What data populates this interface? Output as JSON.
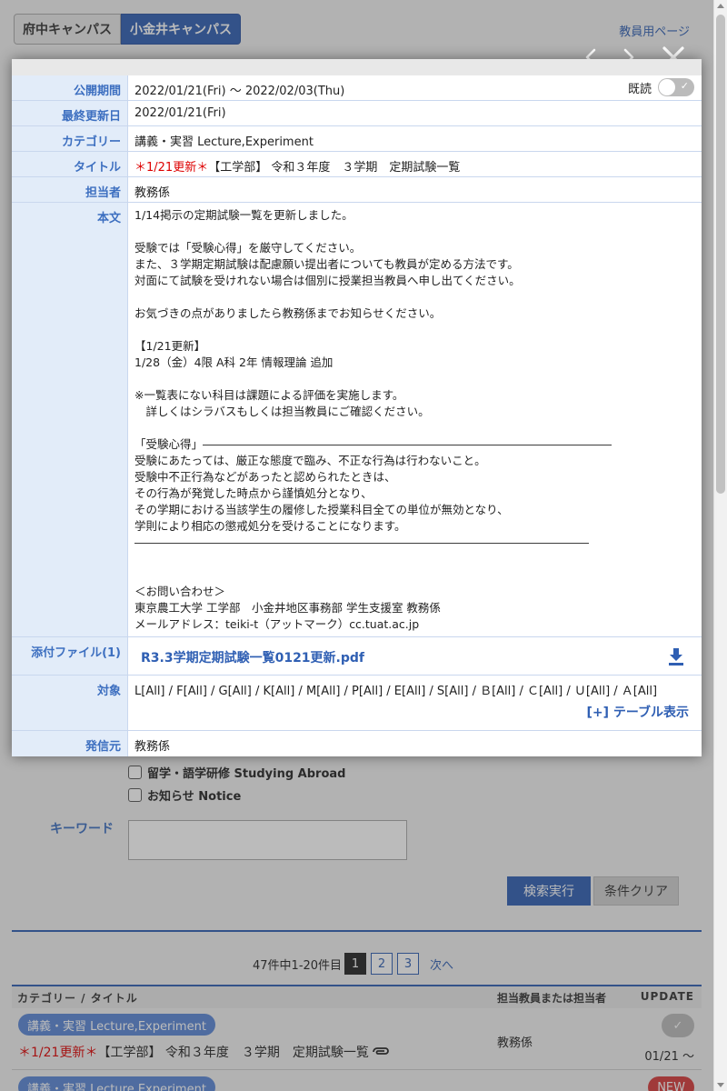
{
  "header": {
    "campus_tabs": [
      {
        "label": "府中キャンパス",
        "active": false
      },
      {
        "label": "小金井キャンパス",
        "active": true
      }
    ],
    "faculty_link": "教員用ページ"
  },
  "detail": {
    "rows": {
      "period": {
        "label": "公開期間",
        "value": "2022/01/21(Fri) 〜 2022/02/03(Thu)"
      },
      "updated": {
        "label": "最終更新日",
        "value": "2022/01/21(Fri)"
      },
      "category": {
        "label": "カテゴリー",
        "value": "講義・実習 Lecture,Experiment"
      },
      "title": {
        "label": "タイトル",
        "prefix": "＊1/21更新＊",
        "value": "【工学部】 令和３年度　３学期　定期試験一覧"
      },
      "person": {
        "label": "担当者",
        "value": "教務係"
      },
      "body": {
        "label": "本文",
        "value": "1/14掲示の定期試験一覧を更新しました。\n\n受験では「受験心得」を厳守してください。\nまた、３学期定期試験は配慮願い提出者についても教員が定める方法です。\n対面にて試験を受けれない場合は個別に授業担当教員へ申し出てください。\n\nお気づきの点がありましたら教務係までお知らせください。\n\n【1/21更新】\n1/28（金）4限 A科 2年 情報理論 追加\n\n※一覧表にない科目は課題による評価を実施します。\n　詳しくはシラバスもしくは担当教員にご確認ください。\n\n「受験心得」――――――――――――――――――――――――――――――――――――\n受験にあたっては、厳正な態度で臨み、不正な行為は行わないこと。\n受験中不正行為などがあったと認められたときは、\nその行為が発覚した時点から謹慎処分となり、\nその学期における当該学生の履修した授業科目全ての単位が無効となり、\n学則により相応の懲戒処分を受けることになります。\n――――――――――――――――――――――――――――――――――――――――\n\n\n＜お問い合わせ＞\n東京農工大学 工学部　小金井地区事務部 学生支援室 教務係\nメールアドレス：teiki-t（アットマーク）cc.tuat.ac.jp"
      },
      "attachment": {
        "label": "添付ファイル(1)",
        "file": "R3.3学期定期試験一覧0121更新.pdf"
      },
      "target": {
        "label": "対象",
        "value": "L[All] / F[All] / G[All] / K[All] / M[All] / P[All] / E[All] / S[All] / Ｂ[All] / Ｃ[All] / Ｕ[All] / Ａ[All]",
        "table_toggle": "[+] テーブル表示"
      },
      "sender": {
        "label": "発信元",
        "value": "教務係"
      }
    },
    "read_label": "既読",
    "read_checked": false
  },
  "search": {
    "checkboxes": [
      "留学・語学研修 Studying Abroad",
      "お知らせ Notice"
    ],
    "keyword_label": "キーワード",
    "search_button": "検索実行",
    "clear_button": "条件クリア"
  },
  "pager": {
    "count_text": "47件中1-20件目",
    "pages": [
      "1",
      "2",
      "3"
    ],
    "current": "1",
    "next": "次へ"
  },
  "list": {
    "headers": {
      "category": "カテゴリー / タイトル",
      "person": "担当教員または担当者",
      "update": "UPDATE"
    },
    "rows": [
      {
        "category": "講義・実習 Lecture,Experiment",
        "prefix": "＊1/21更新＊",
        "title": "【工学部】 令和３年度　３学期　定期試験一覧",
        "person": "教務係",
        "date": "01/21 〜",
        "status": "read"
      },
      {
        "category": "講義・実習 Lecture,Experiment",
        "status": "NEW"
      }
    ]
  },
  "colors": {
    "accent": "#2f5fb3",
    "label_bg": "#e2ecf9",
    "alert": "#dd0000",
    "new_badge": "#d63a3a"
  }
}
